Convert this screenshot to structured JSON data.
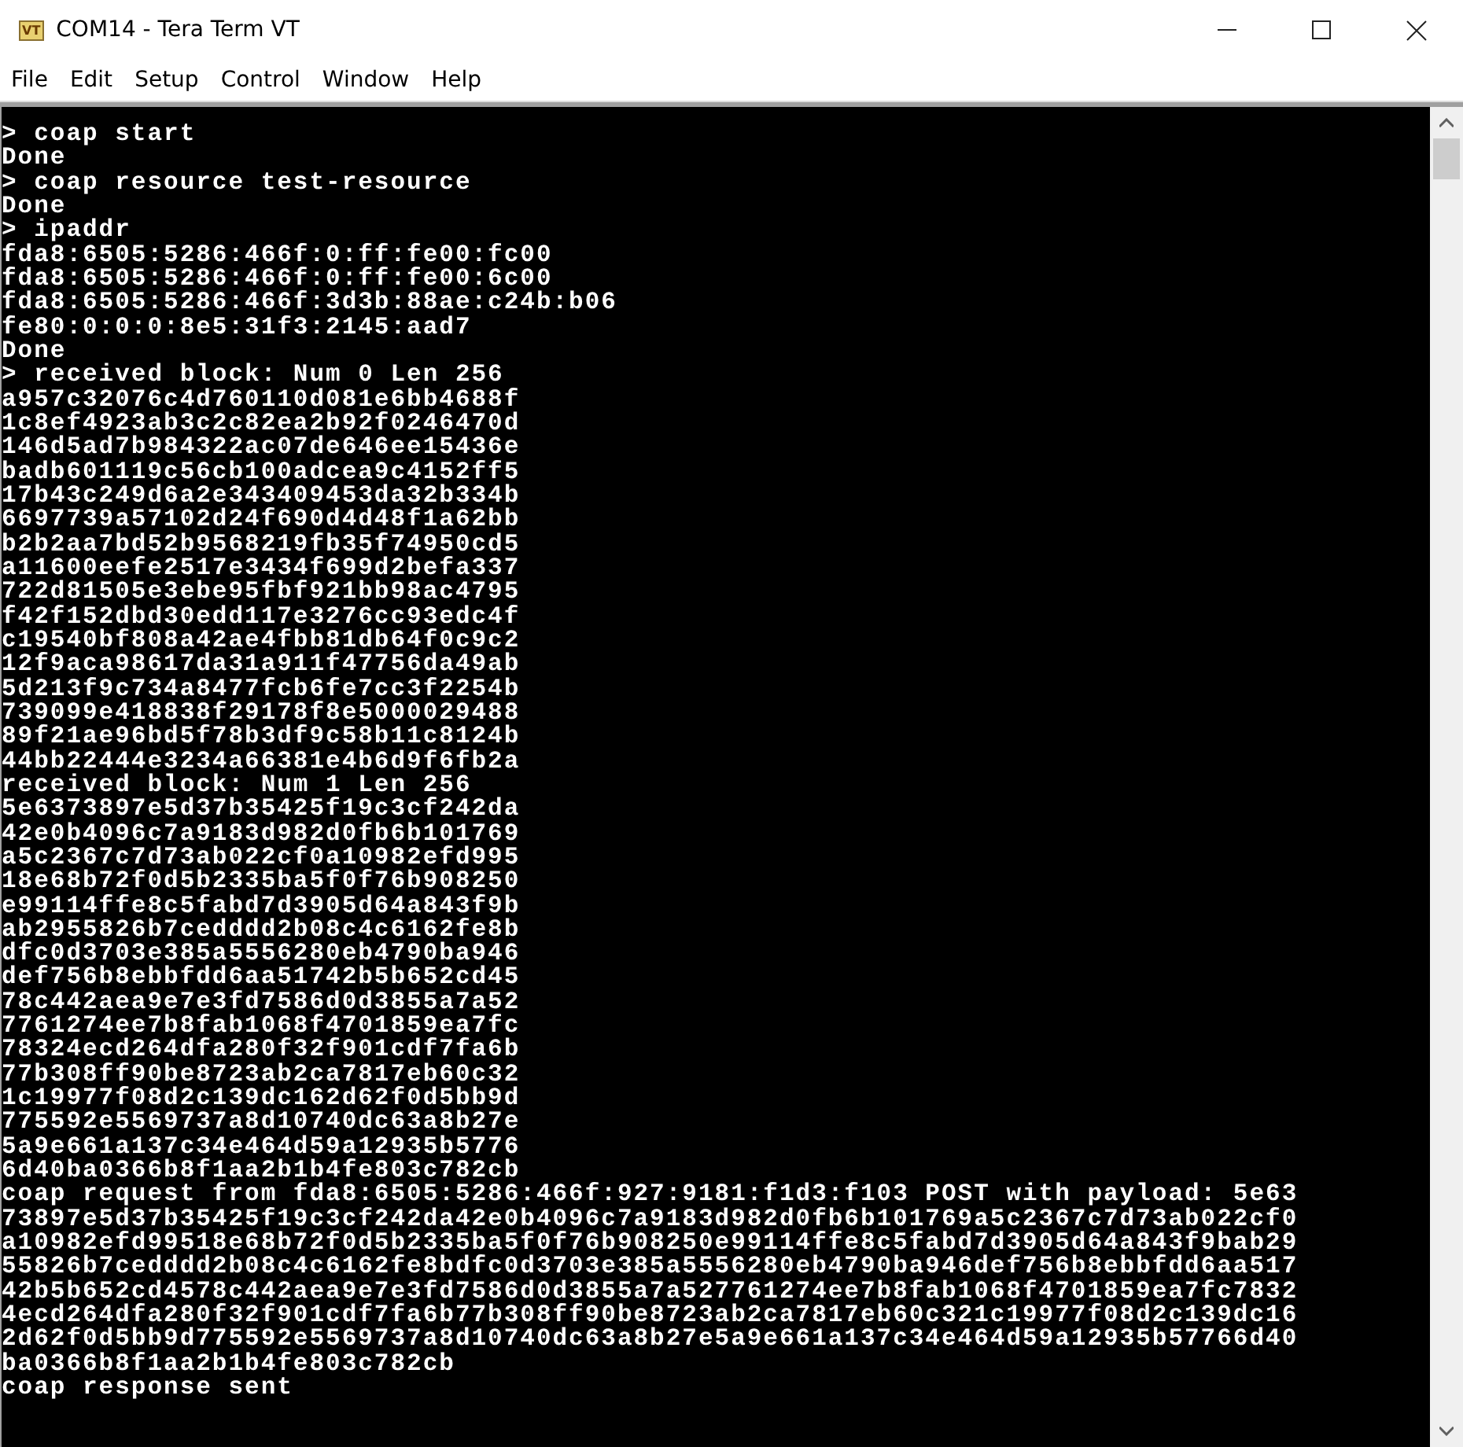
{
  "window": {
    "title": "COM14 - Tera Term VT",
    "icon_text": "VT"
  },
  "menu": [
    "File",
    "Edit",
    "Setup",
    "Control",
    "Window",
    "Help"
  ],
  "terminal": {
    "lines": [
      "> coap start",
      "Done",
      "> coap resource test-resource",
      "Done",
      "> ipaddr",
      "fda8:6505:5286:466f:0:ff:fe00:fc00",
      "fda8:6505:5286:466f:0:ff:fe00:6c00",
      "fda8:6505:5286:466f:3d3b:88ae:c24b:b06",
      "fe80:0:0:0:8e5:31f3:2145:aad7",
      "Done",
      "> received block: Num 0 Len 256",
      "a957c32076c4d760110d081e6bb4688f",
      "1c8ef4923ab3c2c82ea2b92f0246470d",
      "146d5ad7b984322ac07de646ee15436e",
      "badb601119c56cb100adcea9c4152ff5",
      "17b43c249d6a2e343409453da32b334b",
      "6697739a57102d24f690d4d48f1a62bb",
      "b2b2aa7bd52b9568219fb35f74950cd5",
      "a11600eefe2517e3434f699d2befa337",
      "722d81505e3ebe95fbf921bb98ac4795",
      "f42f152dbd30edd117e3276cc93edc4f",
      "c19540bf808a42ae4fbb81db64f0c9c2",
      "12f9aca98617da31a911f47756da49ab",
      "5d213f9c734a8477fcb6fe7cc3f2254b",
      "739099e418838f29178f8e5000029488",
      "89f21ae96bd5f78b3df9c58b11c8124b",
      "44bb22444e3234a66381e4b6d9f6fb2a",
      "received block: Num 1 Len 256",
      "5e6373897e5d37b35425f19c3cf242da",
      "42e0b4096c7a9183d982d0fb6b101769",
      "a5c2367c7d73ab022cf0a10982efd995",
      "18e68b72f0d5b2335ba5f0f76b908250",
      "e99114ffe8c5fabd7d3905d64a843f9b",
      "ab2955826b7cedddd2b08c4c6162fe8b",
      "dfc0d3703e385a5556280eb4790ba946",
      "def756b8ebbfdd6aa51742b5b652cd45",
      "78c442aea9e7e3fd7586d0d3855a7a52",
      "7761274ee7b8fab1068f4701859ea7fc",
      "78324ecd264dfa280f32f901cdf7fa6b",
      "77b308ff90be8723ab2ca7817eb60c32",
      "1c19977f08d2c139dc162d62f0d5bb9d",
      "775592e5569737a8d10740dc63a8b27e",
      "5a9e661a137c34e464d59a12935b5776",
      "6d40ba0366b8f1aa2b1b4fe803c782cb",
      "coap request from fda8:6505:5286:466f:927:9181:f1d3:f103 POST with payload: 5e63",
      "73897e5d37b35425f19c3cf242da42e0b4096c7a9183d982d0fb6b101769a5c2367c7d73ab022cf0",
      "a10982efd99518e68b72f0d5b2335ba5f0f76b908250e99114ffe8c5fabd7d3905d64a843f9bab29",
      "55826b7cedddd2b08c4c6162fe8bdfc0d3703e385a5556280eb4790ba946def756b8ebbfdd6aa517",
      "42b5b652cd4578c442aea9e7e3fd7586d0d3855a7a527761274ee7b8fab1068f4701859ea7fc7832",
      "4ecd264dfa280f32f901cdf7fa6b77b308ff90be8723ab2ca7817eb60c321c19977f08d2c139dc16",
      "2d62f0d5bb9d775592e5569737a8d10740dc63a8b27e5a9e661a137c34e464d59a12935b57766d40",
      "ba0366b8f1aa2b1b4fe803c782cb",
      "coap response sent"
    ]
  }
}
